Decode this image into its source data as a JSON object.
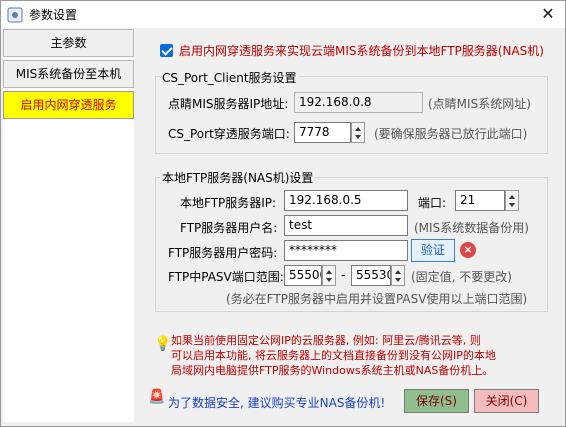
{
  "window": {
    "title": "参数设置"
  },
  "sidebar": {
    "items": [
      {
        "label": "主参数"
      },
      {
        "label": "MIS系统备份至本机"
      },
      {
        "label": "启用内网穿透服务"
      }
    ]
  },
  "enable": {
    "label": "启用内网穿透服务来实现云端MIS系统备份到本地FTP服务器(NAS机)",
    "checked": true
  },
  "cs_port": {
    "legend": "CS_Port_Client服务设置",
    "server_ip_label": "点睛MIS服务器IP地址:",
    "server_ip_value": "192.168.0.8",
    "server_ip_hint": "(点睛MIS系统网址)",
    "port_label": "CS_Port穿透服务端口:",
    "port_value": "7778",
    "port_hint": "(要确保服务器已放行此端口)"
  },
  "ftp": {
    "legend": "本地FTP服务器(NAS机)设置",
    "ip_label": "本地FTP服务器IP:",
    "ip_value": "192.168.0.5",
    "port_label": "端口:",
    "port_value": "21",
    "user_label": "FTP服务器用户名:",
    "user_value": "test",
    "user_hint": "(MIS系统数据备份用)",
    "pwd_label": "FTP服务器用户密码:",
    "pwd_value": "********",
    "verify_label": "验证",
    "pasv_label": "FTP中PASV端口范围:",
    "pasv_from": "55500",
    "pasv_sep": "-",
    "pasv_to": "55530",
    "pasv_hint": "(固定值, 不要更改)",
    "pasv_note": "(务必在FTP服务器中启用并设置PASV使用以上端口范围)"
  },
  "tip": {
    "line1": "如果当前使用固定公网IP的云服务器, 例如: 阿里云/腾讯云等, 则",
    "line2": "可以启用本功能, 将云服务器上的文档直接备份到没有公网IP的本地",
    "line3": "局域网内电脑提供FTP服务的Windows系统主机或NAS备份机上。"
  },
  "footer": {
    "notice": "为了数据安全, 建议购买专业NAS备份机!",
    "save_label": "保存(S)",
    "close_label": "关闭(C)"
  },
  "colors": {
    "accent": "#0b6bd8",
    "sidebar_active_bg": "#ffff00",
    "sidebar_active_fg": "#d40000",
    "warning": "#c00000"
  }
}
